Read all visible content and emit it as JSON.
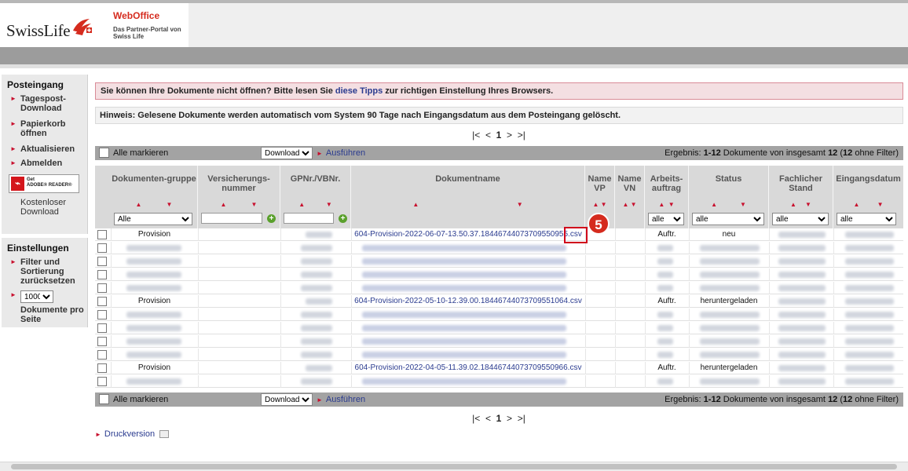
{
  "header": {
    "logo_text": "SwissLife",
    "brand_title": "WebOffice",
    "brand_subtitle": "Das Partner-Portal von Swiss Life"
  },
  "sidebar": {
    "section1_title": "Posteingang",
    "items": [
      {
        "label": "Tagespost-Download"
      },
      {
        "label": "Papierkorb öffnen"
      },
      {
        "label": "Aktualisieren"
      },
      {
        "label": "Abmelden"
      }
    ],
    "adobe_get": "Get",
    "adobe_reader": "ADOBE® READER®",
    "kostenlos": "Kostenloser Download",
    "section2_title": "Einstellungen",
    "filter_reset": "Filter und Sortierung zurücksetzen",
    "per_page_value": "1000",
    "per_page_label": "Dokumente pro Seite"
  },
  "messages": {
    "alert_before": "Sie können Ihre Dokumente nicht öffnen? Bitte lesen Sie ",
    "alert_link": "diese Tipps",
    "alert_after": " zur richtigen Einstellung Ihres Browsers.",
    "info": "Hinweis: Gelesene Dokumente werden automatisch vom System 90 Tage nach Eingangsdatum aus dem Posteingang gelöscht."
  },
  "pager": {
    "first": "|<",
    "prev": "<",
    "current": "1",
    "next": ">",
    "last": ">|"
  },
  "actionbar": {
    "select_all": "Alle markieren",
    "action_value": "Download",
    "execute": "Ausführen",
    "result_prefix": "Ergebnis: ",
    "result_range": "1-12",
    "result_mid": " Dokumente von insgesamt ",
    "result_total": "12",
    "result_suffix": " (",
    "result_total2": "12",
    "result_end": " ohne Filter)"
  },
  "table": {
    "columns": [
      {
        "label": "Dokumenten-gruppe",
        "filter": "Alle"
      },
      {
        "label": "Versicherungs-nummer",
        "filter": ""
      },
      {
        "label": "GPNr./VBNr.",
        "filter": ""
      },
      {
        "label": "Dokumentname",
        "filter": ""
      },
      {
        "label": "Name VP",
        "filter": ""
      },
      {
        "label": "Name VN",
        "filter": ""
      },
      {
        "label": "Arbeits-auftrag",
        "filter": "alle"
      },
      {
        "label": "Status",
        "filter": "alle"
      },
      {
        "label": "Fachlicher Stand",
        "filter": "alle"
      },
      {
        "label": "Eingangsdatum",
        "filter": "alle"
      }
    ],
    "rows": [
      {
        "gruppe": "Provision",
        "name": "604-Provision-2022-06-07-13.50.37.18446744073709550955.csv",
        "auftrag": "Auftr.",
        "status": "neu",
        "visible": true
      },
      {
        "visible": false
      },
      {
        "visible": false
      },
      {
        "visible": false
      },
      {
        "visible": false
      },
      {
        "gruppe": "Provision",
        "name": "604-Provision-2022-05-10-12.39.00.18446744073709551064.csv",
        "auftrag": "Auftr.",
        "status": "heruntergeladen",
        "visible": true
      },
      {
        "visible": false
      },
      {
        "visible": false
      },
      {
        "visible": false
      },
      {
        "visible": false
      },
      {
        "gruppe": "Provision",
        "name": "604-Provision-2022-04-05-11.39.02.18446744073709550966.csv",
        "auftrag": "Auftr.",
        "status": "heruntergeladen",
        "visible": true
      },
      {
        "visible": false
      }
    ]
  },
  "annotation": {
    "badge": "5"
  },
  "footer": {
    "print": "Druckversion"
  },
  "colors": {
    "brand_red": "#d52b1e",
    "link_blue": "#2a3b8f",
    "bar_grey": "#a3a3a3"
  }
}
